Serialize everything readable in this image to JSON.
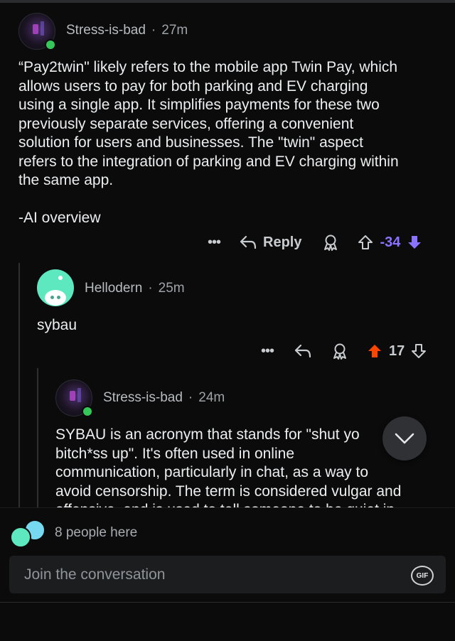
{
  "comments": [
    {
      "author": "Stress-is-bad",
      "time": "27m",
      "body": "“Pay2twin\" likely refers to the mobile app Twin Pay, which\nallows users to pay for both parking and EV charging\nusing a single app. It simplifies payments for these two\npreviously separate services, offering a convenient\nsolution for users and businesses. The \"twin\" aspect\nrefers to the integration of parking and EV charging within\nthe same app.\n\n-AI overview",
      "reply_label": "Reply",
      "score": "-34",
      "vote": "down"
    },
    {
      "author": "Hellodern",
      "time": "25m",
      "body": "sybau",
      "score": "17",
      "vote": "up"
    },
    {
      "author": "Stress-is-bad",
      "time": "24m",
      "body": "SYBAU is an acronym that stands for \"shut yo\nbitch*ss up\". It's often used in online\ncommunication, particularly in chat, as a way to\navoid censorship. The term is considered vulgar and\noffensive, and is used to tell someone to be quiet in"
    }
  ],
  "presence": {
    "text": "8 people here"
  },
  "composer": {
    "placeholder": "Join the conversation",
    "gif_label": "GIF"
  },
  "colors": {
    "downvote": "#8b73ff",
    "upvote": "#ff4500",
    "background": "#0b0b0c"
  },
  "icons": [
    "more-icon",
    "reply-icon",
    "award-icon",
    "upvote-icon",
    "downvote-icon",
    "chevron-down-icon",
    "gif-icon"
  ]
}
